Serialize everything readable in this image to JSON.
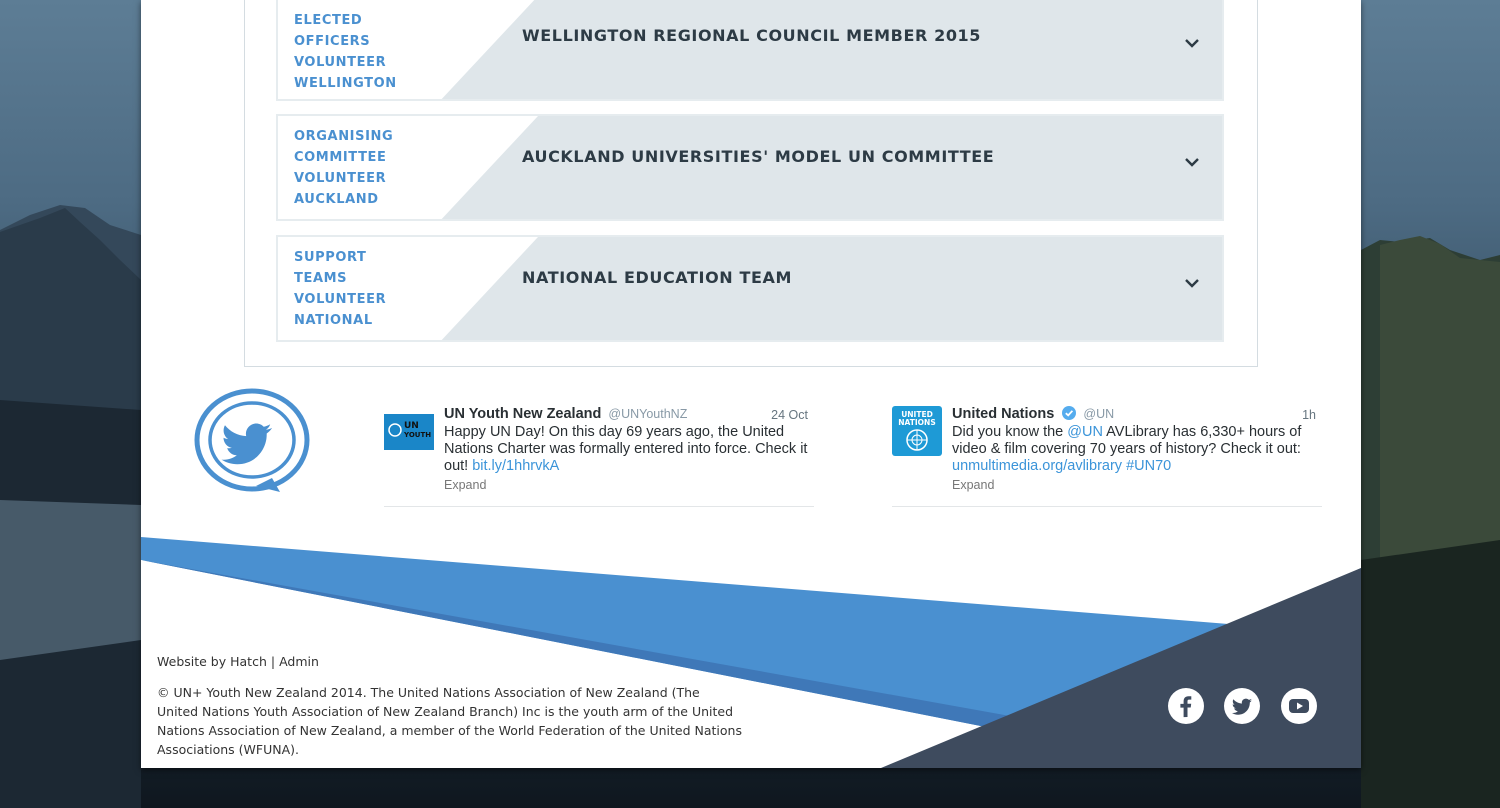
{
  "roles": [
    {
      "tags": [
        "Elected",
        "Officers",
        "Volunteer",
        "Wellington"
      ],
      "title": "WELLINGTON REGIONAL COUNCIL MEMBER 2015"
    },
    {
      "tags": [
        "Organising",
        "Committee",
        "Volunteer",
        "Auckland"
      ],
      "title": "AUCKLAND UNIVERSITIES' MODEL UN COMMITTEE"
    },
    {
      "tags": [
        "Support",
        "Teams",
        "Volunteer",
        "National"
      ],
      "title": "NATIONAL EDUCATION TEAM"
    }
  ],
  "tweets": [
    {
      "avatar_text": "UN YOUTH",
      "name": "UN Youth New Zealand",
      "handle": "@UNYouthNZ",
      "time": "24 Oct",
      "text": "Happy UN Day! On this day 69 years ago, the United Nations Charter was formally entered into force. Check it out!",
      "links": [
        "bit.ly/1hhrvkA"
      ],
      "expand": "Expand"
    },
    {
      "avatar_text": "UNITED NATIONS",
      "name": "United Nations",
      "handle": "@UN",
      "time": "1h",
      "text_before": "Did you know the",
      "mention": "@UN",
      "text_after": "AVLibrary has 6,330+ hours of video & film covering 70 years of history? Check it out:",
      "links": [
        "unmultimedia.org/avlibrary",
        "#UN70"
      ],
      "expand": "Expand"
    }
  ],
  "footer": {
    "credit_prefix": "Website by",
    "credit_link": "Hatch",
    "separator": "|",
    "admin_link": "Admin",
    "copyright": "© UN+ Youth New Zealand 2014. The United Nations Association of New Zealand (The United Nations Youth Association of New Zealand Branch) Inc is the youth arm of the United Nations Association of New Zealand, a member of the World Federation of the United Nations Associations (WFUNA).",
    "social_icons": [
      "facebook-icon",
      "twitter-icon",
      "youtube-icon"
    ]
  },
  "colors": {
    "accent_blue": "#4a90d0",
    "navy": "#3e4b5e",
    "role_bg": "#dfe6ea"
  }
}
